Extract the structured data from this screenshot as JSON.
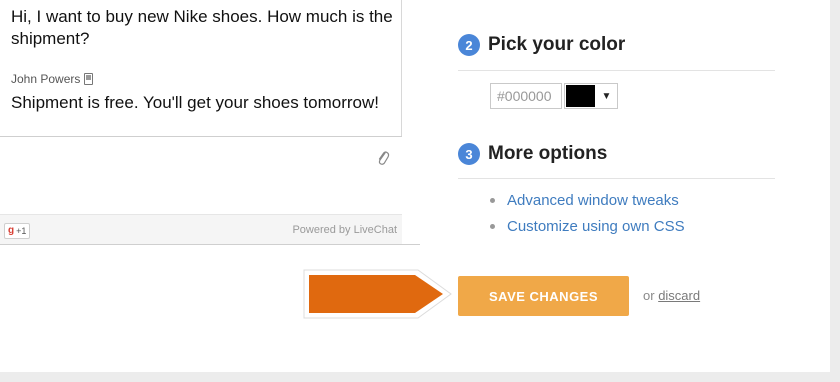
{
  "chat": {
    "visitor_message": "Hi, I want to buy new Nike shoes. How much is the shipment?",
    "agent_name": "John Powers",
    "agent_message": "Shipment is free. You'll get your shoes tomorrow!",
    "gplus_label": "+1",
    "gplus_g": "g",
    "powered_by": "Powered by LiveChat"
  },
  "settings": {
    "step2": {
      "number": "2",
      "title": "Pick your color"
    },
    "color": {
      "value": "#000000",
      "swatch": "#000000",
      "arrow": "▼"
    },
    "step3": {
      "number": "3",
      "title": "More options"
    },
    "options": [
      "Advanced window tweaks",
      "Customize using own CSS"
    ],
    "save_label": "SAVE CHANGES",
    "or_label": "or",
    "discard_label": "discard"
  },
  "colors": {
    "accent_blue": "#4a86d8",
    "link_blue": "#3f7cbf",
    "save_orange": "#f0a848",
    "arrow_orange": "#e0690f"
  },
  "icons": [
    "phone-icon",
    "paperclip-icon",
    "orange-arrow-pointer"
  ]
}
